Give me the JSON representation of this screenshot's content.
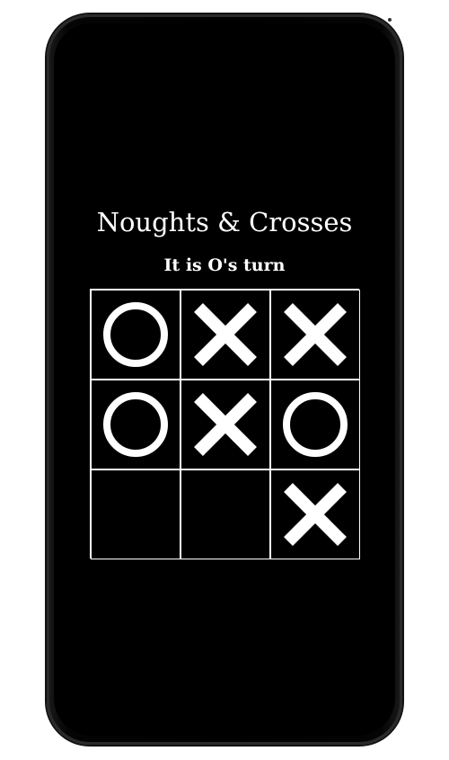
{
  "game": {
    "title": "Noughts & Crosses",
    "status": "It is O's turn",
    "board": [
      "O",
      "X",
      "X",
      "O",
      "X",
      "O",
      "",
      "",
      "X"
    ]
  },
  "colors": {
    "background": "#000000",
    "mark": "#ffffff",
    "grid": "#ffffff"
  },
  "icons": {
    "nought": "circle-icon",
    "cross": "x-icon"
  }
}
